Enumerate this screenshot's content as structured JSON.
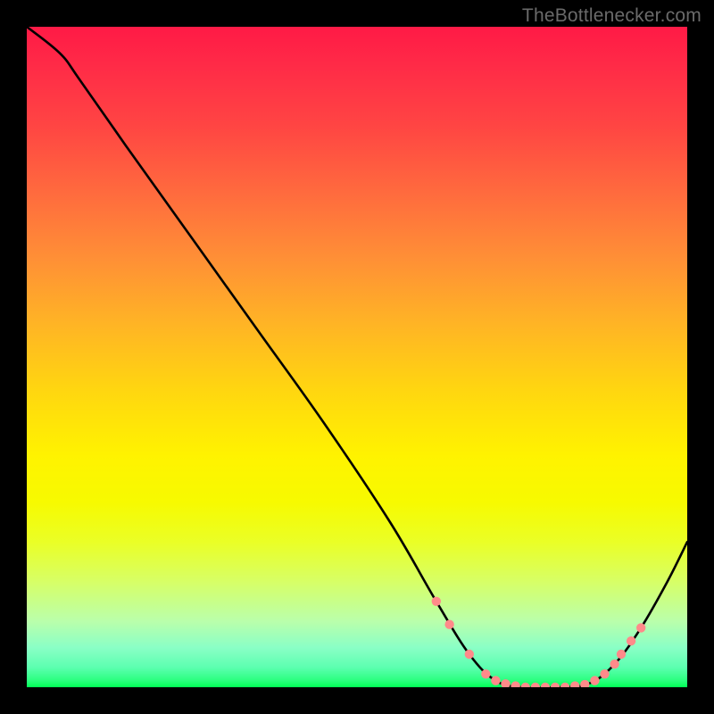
{
  "attribution": "TheBottlenecker.com",
  "chart_data": {
    "type": "line",
    "title": "",
    "xlabel": "",
    "ylabel": "",
    "xlim": [
      0,
      100
    ],
    "ylim": [
      0,
      100
    ],
    "curve": [
      {
        "x": 0,
        "y": 100
      },
      {
        "x": 5,
        "y": 96
      },
      {
        "x": 8,
        "y": 92
      },
      {
        "x": 15,
        "y": 82
      },
      {
        "x": 25,
        "y": 68
      },
      {
        "x": 35,
        "y": 54
      },
      {
        "x": 45,
        "y": 40
      },
      {
        "x": 55,
        "y": 25
      },
      {
        "x": 62,
        "y": 13
      },
      {
        "x": 67,
        "y": 5
      },
      {
        "x": 71,
        "y": 1
      },
      {
        "x": 75,
        "y": 0
      },
      {
        "x": 80,
        "y": 0
      },
      {
        "x": 85,
        "y": 0.5
      },
      {
        "x": 89,
        "y": 3.5
      },
      {
        "x": 93,
        "y": 9
      },
      {
        "x": 97,
        "y": 16
      },
      {
        "x": 100,
        "y": 22
      }
    ],
    "series": [
      {
        "name": "dots",
        "color": "#ff8a8a",
        "points": [
          {
            "x": 62,
            "y": 13
          },
          {
            "x": 64,
            "y": 9.5
          },
          {
            "x": 67,
            "y": 5
          },
          {
            "x": 69.5,
            "y": 2
          },
          {
            "x": 71,
            "y": 1
          },
          {
            "x": 72.5,
            "y": 0.5
          },
          {
            "x": 74,
            "y": 0.2
          },
          {
            "x": 75.5,
            "y": 0
          },
          {
            "x": 77,
            "y": 0
          },
          {
            "x": 78.5,
            "y": 0
          },
          {
            "x": 80,
            "y": 0
          },
          {
            "x": 81.5,
            "y": 0
          },
          {
            "x": 83,
            "y": 0.2
          },
          {
            "x": 84.5,
            "y": 0.4
          },
          {
            "x": 86,
            "y": 1
          },
          {
            "x": 87.5,
            "y": 2
          },
          {
            "x": 89,
            "y": 3.5
          },
          {
            "x": 90,
            "y": 5
          },
          {
            "x": 91.5,
            "y": 7
          },
          {
            "x": 93,
            "y": 9
          }
        ]
      }
    ],
    "background": {
      "type": "vertical-gradient",
      "stops": [
        {
          "pos": 0,
          "color": "#ff1a46"
        },
        {
          "pos": 50,
          "color": "#ffcf10"
        },
        {
          "pos": 72,
          "color": "#fff300"
        },
        {
          "pos": 100,
          "color": "#00ff55"
        }
      ]
    }
  }
}
